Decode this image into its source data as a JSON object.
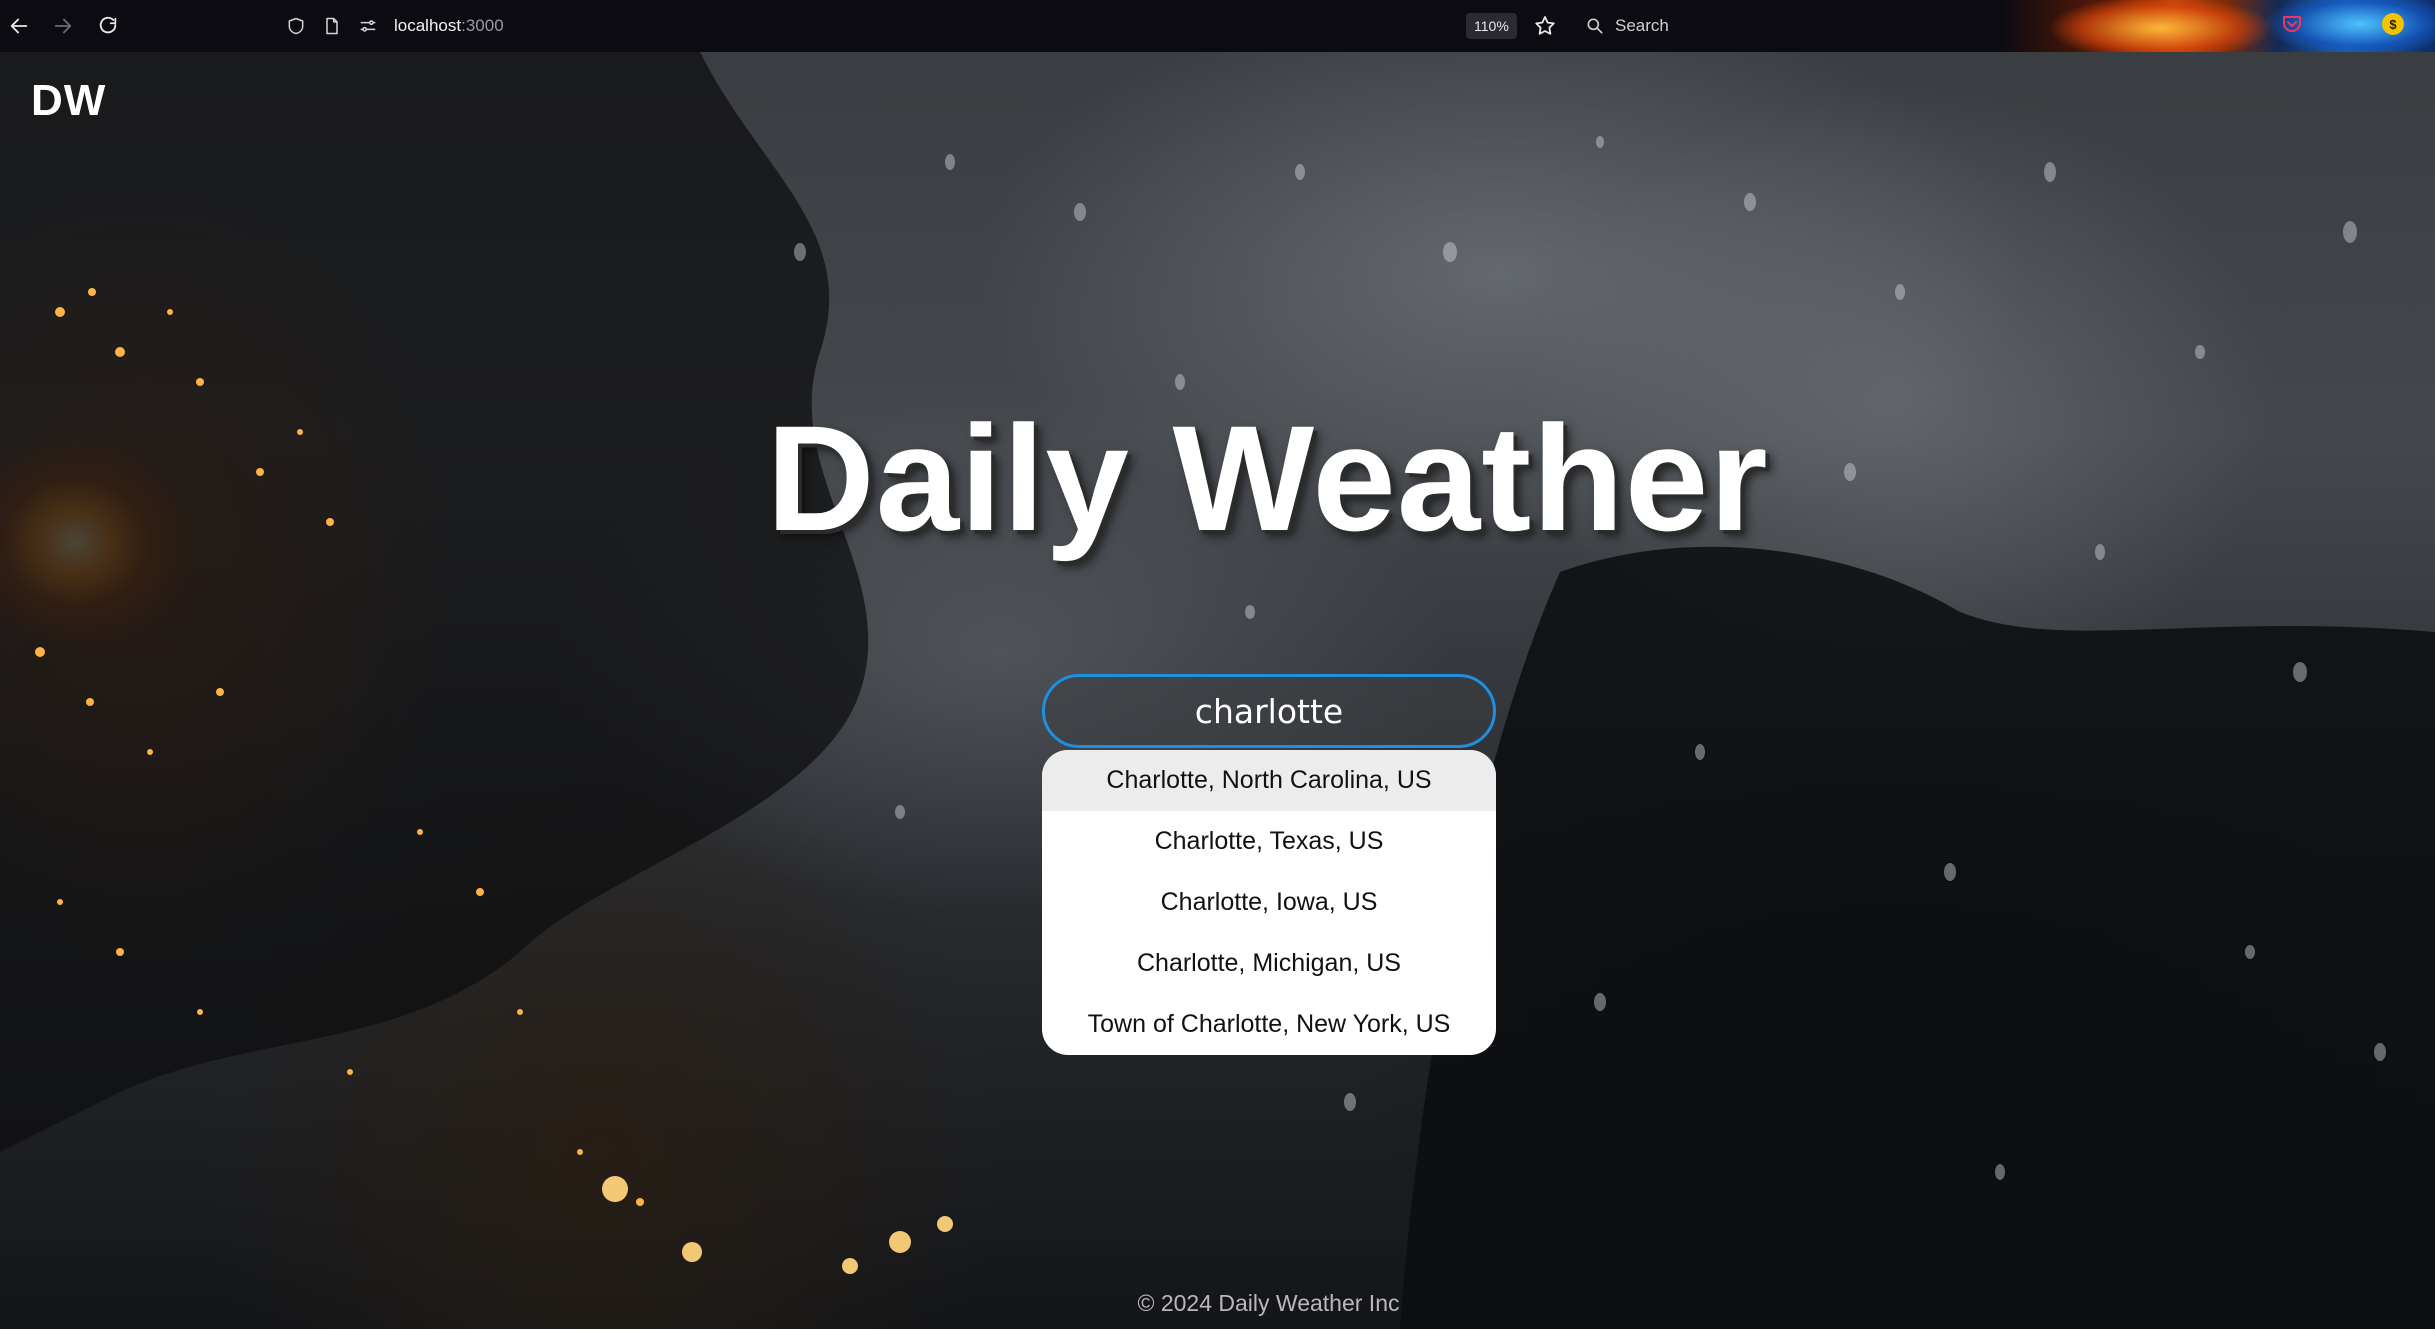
{
  "browser": {
    "url_host": "localhost",
    "url_port": ":3000",
    "zoom": "110%",
    "search_label": "Search",
    "extension_badge": "$"
  },
  "site": {
    "logo": "DW",
    "title": "Daily Weather",
    "footer": "© 2024 Daily Weather Inc"
  },
  "search": {
    "value": "charlotte",
    "suggestions": [
      "Charlotte, North Carolina, US",
      "Charlotte, Texas, US",
      "Charlotte, Iowa, US",
      "Charlotte, Michigan, US",
      "Town of Charlotte, New York, US"
    ],
    "active_index": 0
  },
  "colors": {
    "focus_ring": "#1f8fe0",
    "toolbar_bg": "#0b0b11"
  }
}
